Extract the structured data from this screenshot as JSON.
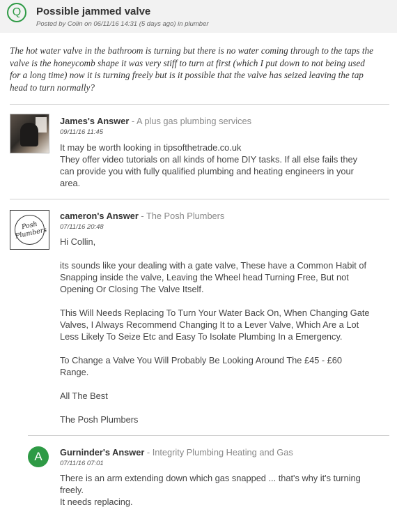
{
  "question": {
    "icon_letter": "Q",
    "title": "Possible jammed valve",
    "meta": "Posted by Colin on 06/11/16 14:31 (5 days ago) in plumber",
    "body_lines": [
      "The hot water valve in the bathroom is turning but there is no water coming through to the taps the",
      "valve is the honeycomb shape it was very stiff to turn at first (which I put down to not being used",
      "for a long time) now it is turning freely but is it possible that the valve has seized leaving the tap",
      "head to turn normally?"
    ]
  },
  "answers": [
    {
      "author": "James's Answer",
      "company": " - A plus gas plumbing services",
      "date": "09/11/16 11:45",
      "lines": [
        "It may be worth looking in tipsofthetrade.co.uk",
        "They offer video tutorials on all kinds of home DIY tasks. If all else fails they",
        "can provide you with fully qualified plumbing and heating engineers in your",
        "area."
      ]
    },
    {
      "author": "cameron's Answer",
      "company": " - The Posh Plumbers",
      "date": "07/11/16 20:48",
      "logo_text": "Posh Plumbers",
      "lines": [
        "Hi Collin,",
        "its sounds like your dealing with a gate valve, These have a Common Habit of",
        "Snapping inside the valve, Leaving the Wheel head Turning Free, But not",
        "Opening Or Closing The Valve Itself.",
        "This Will Needs Replacing To Turn Your Water Back On, When Changing Gate",
        "Valves, I Always Recommend Changing It to a Lever Valve, Which Are a Lot",
        "Less Likely To Seize Etc and Easy To Isolate Plumbing In a Emergency.",
        "To Change a Valve You Will Probably Be Looking Around The £45 - £60",
        "Range.",
        "All The Best",
        "The Posh Plumbers"
      ]
    },
    {
      "avatar_letter": "A",
      "author": "Gurninder's Answer",
      "company": " - Integrity Plumbing Heating and Gas",
      "date": "07/11/16 07:01",
      "lines": [
        "There is an arm extending down which gas snapped ... that's why it's turning",
        "freely.",
        "It needs replacing."
      ]
    }
  ],
  "colors": {
    "accent_green": "#2e9a45",
    "header_bg": "#f2f2f2"
  }
}
